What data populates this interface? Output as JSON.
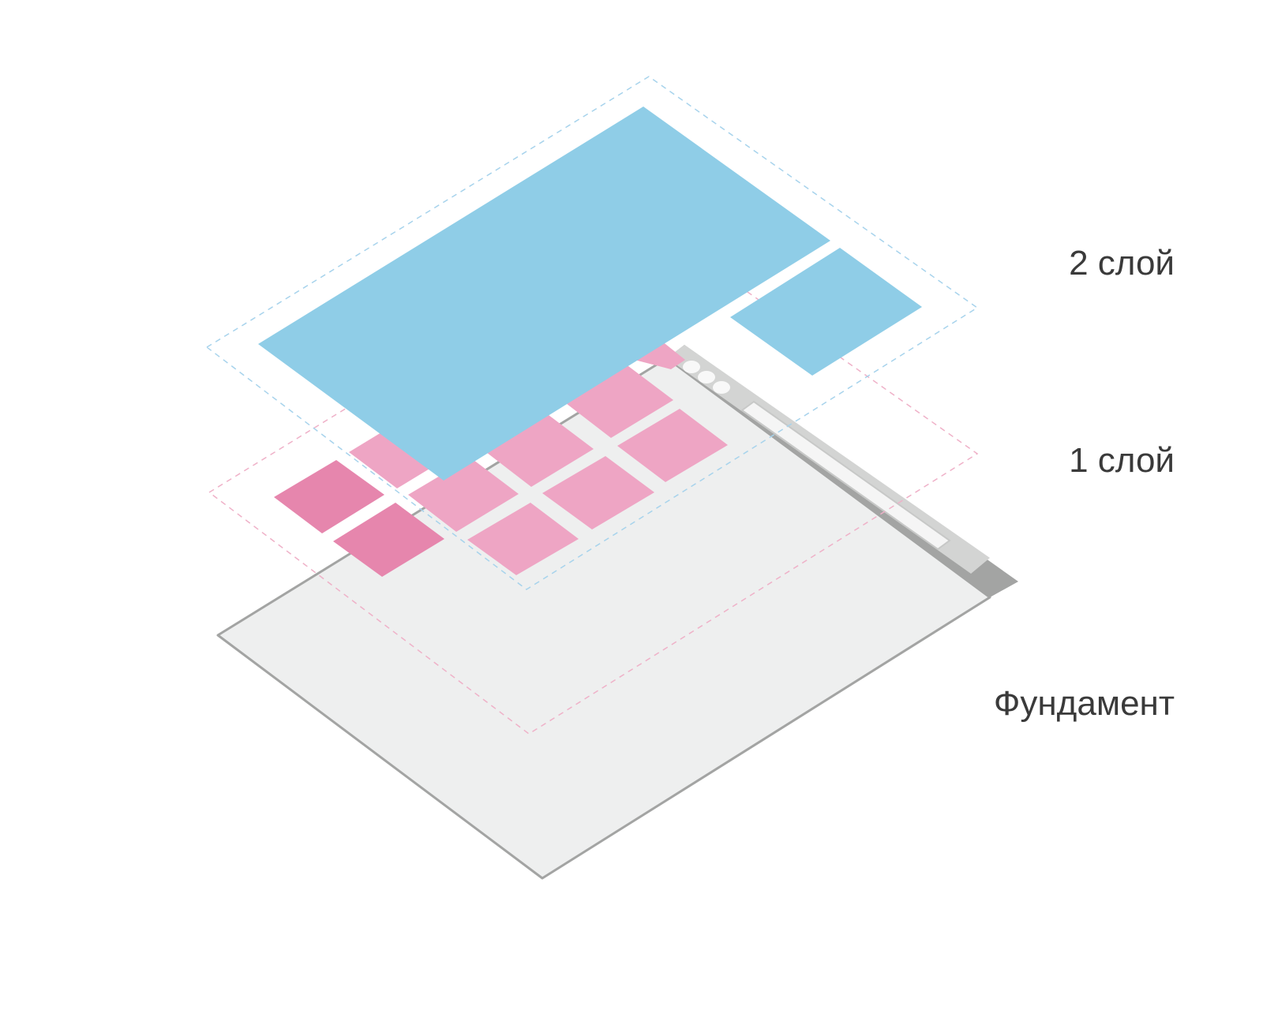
{
  "labels": {
    "layer2": "2 слой",
    "layer1": "1 слой",
    "foundation": "Фундамент"
  },
  "colors": {
    "layer2_fill": "#8fcde7",
    "layer1_fill": "#eea5c4",
    "layer1_accent": "#e686ad",
    "foundation_fill": "#f2f3f3",
    "foundation_edge": "#a3a4a3",
    "foundation_header": "#d3d4d3",
    "dashed_blue": "#a7d3ec",
    "dashed_pink": "#efb1c8"
  }
}
